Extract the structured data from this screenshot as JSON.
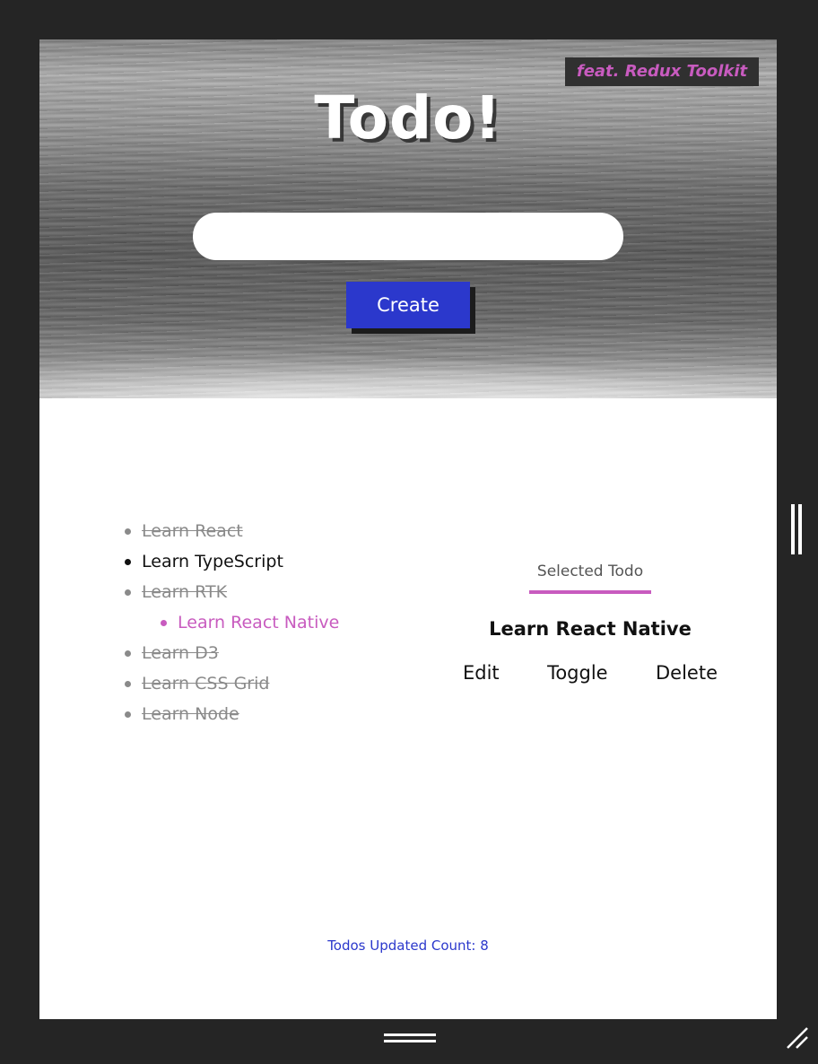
{
  "header": {
    "badge": "feat. Redux Toolkit",
    "title": "Todo!"
  },
  "form": {
    "input_value": "",
    "create_label": "Create"
  },
  "todos": [
    {
      "label": "Learn React",
      "status": "done"
    },
    {
      "label": "Learn TypeScript",
      "status": "active"
    },
    {
      "label": "Learn RTK",
      "status": "done"
    },
    {
      "label": "Learn React Native",
      "status": "selected"
    },
    {
      "label": "Learn D3",
      "status": "done"
    },
    {
      "label": "Learn CSS Grid",
      "status": "done"
    },
    {
      "label": "Learn Node",
      "status": "done"
    }
  ],
  "selected": {
    "label": "Selected Todo",
    "title": "Learn React Native",
    "actions": {
      "edit": "Edit",
      "toggle": "Toggle",
      "delete": "Delete"
    }
  },
  "footer": {
    "count_text": "Todos Updated Count: 8"
  },
  "colors": {
    "accent_pink": "#c85bbf",
    "primary_blue": "#2b38cc",
    "backdrop": "#252525"
  },
  "icons": {
    "right_grip": "vertical-resize-handle-icon",
    "bottom_grip": "horizontal-resize-handle-icon",
    "corner_grip": "corner-resize-icon"
  }
}
